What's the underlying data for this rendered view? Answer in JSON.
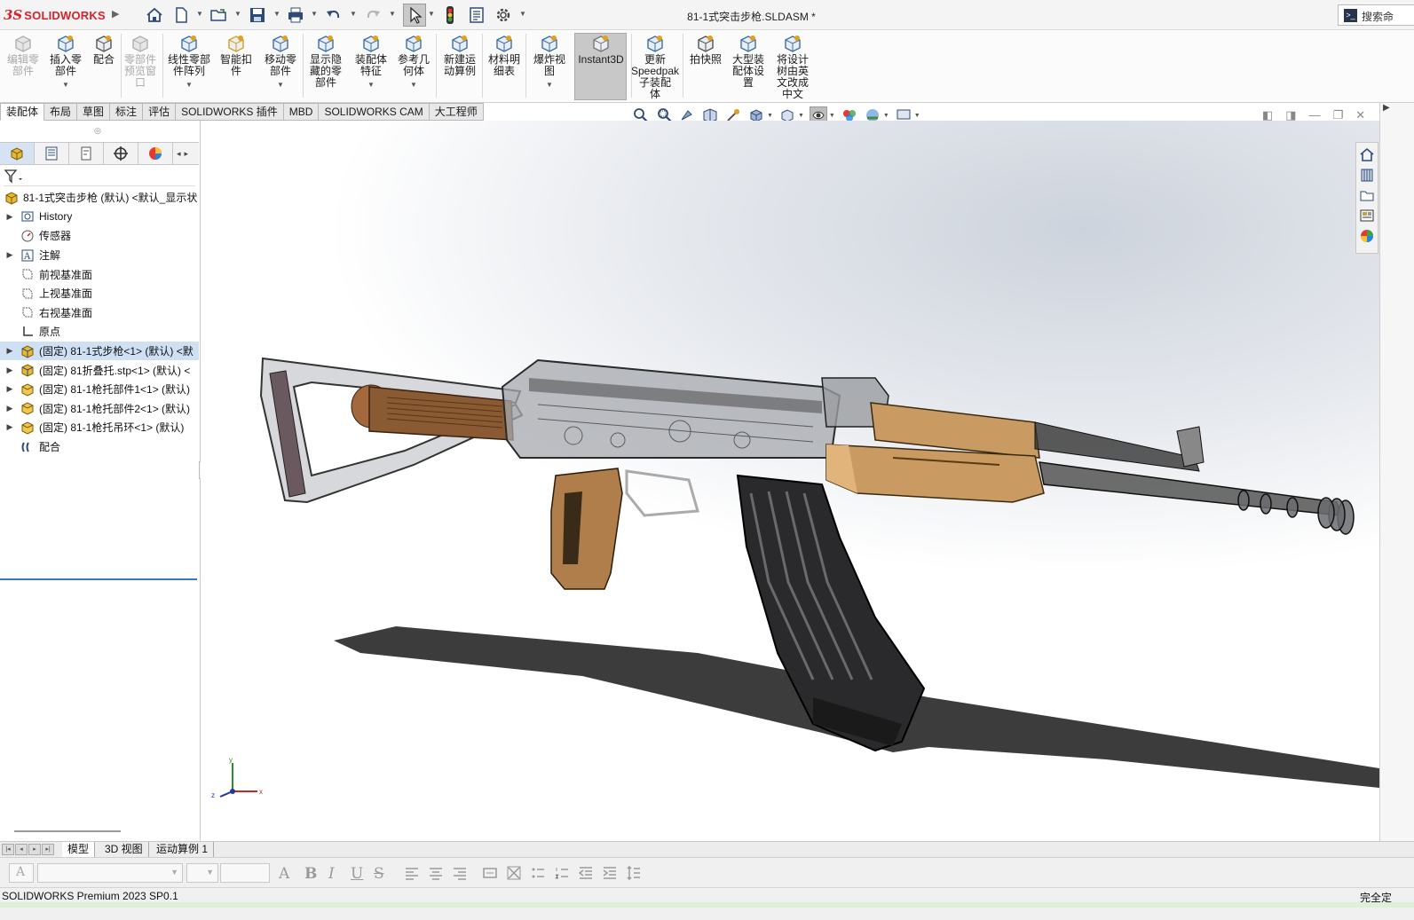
{
  "app": {
    "brand": "SOLIDWORKS",
    "document_title": "81-1式突击步枪.SLDASM *",
    "search_label": "搜索命"
  },
  "ribbon": {
    "buttons": [
      {
        "label": "编辑零\n部件",
        "icon": "edit-component-icon",
        "disabled": true
      },
      {
        "label": "插入零\n部件",
        "icon": "insert-component-icon",
        "disabled": false,
        "caret": true
      },
      {
        "label": "配合",
        "icon": "mate-icon",
        "disabled": false
      },
      {
        "label": "零部件\n预览窗\n口",
        "icon": "component-preview-icon",
        "disabled": true
      },
      {
        "label": "线性零部\n件阵列",
        "icon": "linear-pattern-icon",
        "disabled": false,
        "caret": true
      },
      {
        "label": "智能扣\n件",
        "icon": "smart-fastener-icon",
        "disabled": false
      },
      {
        "label": "移动零\n部件",
        "icon": "move-component-icon",
        "disabled": false,
        "caret": true
      },
      {
        "label": "显示隐\n藏的零\n部件",
        "icon": "show-hidden-icon",
        "disabled": false
      },
      {
        "label": "装配体\n特征",
        "icon": "assembly-feature-icon",
        "disabled": false,
        "caret": true
      },
      {
        "label": "参考几\n何体",
        "icon": "reference-geometry-icon",
        "disabled": false,
        "caret": true
      },
      {
        "label": "新建运\n动算例",
        "icon": "new-motion-study-icon",
        "disabled": false
      },
      {
        "label": "材料明\n细表",
        "icon": "bom-icon",
        "disabled": false
      },
      {
        "label": "爆炸视\n图",
        "icon": "exploded-view-icon",
        "disabled": false,
        "caret": true
      },
      {
        "label": "Instant3D",
        "icon": "instant3d-icon",
        "disabled": false,
        "active": true
      },
      {
        "label": "更新\nSpeedpak\n子装配\n体",
        "icon": "speedpak-icon",
        "disabled": false
      },
      {
        "label": "拍快照",
        "icon": "snapshot-icon",
        "disabled": false
      },
      {
        "label": "大型装\n配体设\n置",
        "icon": "large-assembly-icon",
        "disabled": false
      },
      {
        "label": "将设计\n树由英\n文改成\n中文",
        "icon": "macro-icon",
        "disabled": false
      }
    ]
  },
  "command_tabs": [
    "装配体",
    "布局",
    "草图",
    "标注",
    "评估",
    "SOLIDWORKS 插件",
    "MBD",
    "SOLIDWORKS CAM",
    "大工程师"
  ],
  "tree": {
    "items": [
      {
        "label": "81-1式突击步枪 (默认) <默认_显示状",
        "icon": "assembly-icon",
        "expander": "",
        "indent": 0
      },
      {
        "label": "History",
        "icon": "history-icon",
        "expander": "▶",
        "indent": 1
      },
      {
        "label": "传感器",
        "icon": "sensor-icon",
        "expander": "",
        "indent": 1
      },
      {
        "label": "注解",
        "icon": "annotation-icon",
        "expander": "▶",
        "indent": 1
      },
      {
        "label": "前视基准面",
        "icon": "plane-icon",
        "expander": "",
        "indent": 1
      },
      {
        "label": "上视基准面",
        "icon": "plane-icon",
        "expander": "",
        "indent": 1
      },
      {
        "label": "右视基准面",
        "icon": "plane-icon",
        "expander": "",
        "indent": 1
      },
      {
        "label": "原点",
        "icon": "origin-icon",
        "expander": "",
        "indent": 1
      },
      {
        "label": "(固定) 81-1式步枪<1> (默认) <默",
        "icon": "subassembly-icon",
        "expander": "▶",
        "indent": 1,
        "selected": true
      },
      {
        "label": "(固定) 81折叠托.stp<1> (默认) <",
        "icon": "subassembly-icon",
        "expander": "▶",
        "indent": 1
      },
      {
        "label": "(固定) 81-1枪托部件1<1> (默认)",
        "icon": "part-icon",
        "expander": "▶",
        "indent": 1
      },
      {
        "label": "(固定) 81-1枪托部件2<1> (默认)",
        "icon": "part-icon",
        "expander": "▶",
        "indent": 1
      },
      {
        "label": "(固定) 81-1枪托吊环<1> (默认)",
        "icon": "part-icon",
        "expander": "▶",
        "indent": 1
      },
      {
        "label": "配合",
        "icon": "mates-folder-icon",
        "expander": "",
        "indent": 1
      }
    ]
  },
  "bottom_tabs": [
    "模型",
    "3D 视图",
    "运动算例 1"
  ],
  "triad": {
    "x": "x",
    "y": "y",
    "z": "z"
  },
  "status": {
    "product": "SOLIDWORKS Premium 2023 SP0.1",
    "right": "完全定"
  }
}
